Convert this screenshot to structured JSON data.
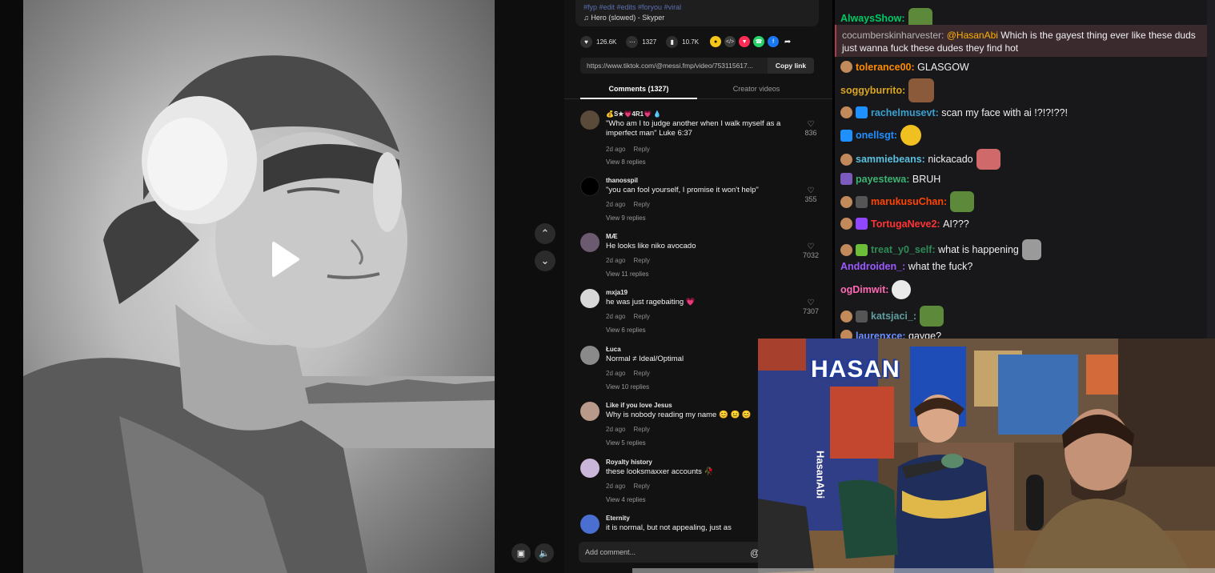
{
  "tiktok": {
    "song_tags": "#fyp #edit #edits #foryou #viral",
    "song": "Hero (slowed) - Skyper",
    "stats": {
      "likes": "126.6K",
      "comments": "1327",
      "saves": "10.7K"
    },
    "link": "https://www.tiktok.com/@messi.fmp/video/753115617...",
    "copy_label": "Copy link",
    "tabs": {
      "comments": "Comments (1327)",
      "creator": "Creator videos"
    },
    "comments": [
      {
        "user": "💰S★💗4R1💗 💧",
        "text": "\"Who am I to judge another when I walk myself as a imperfect man\" Luke 6:37",
        "time": "2d ago",
        "reply": "Reply",
        "views": "View 8 replies",
        "likes": "836"
      },
      {
        "user": "thanosspil",
        "text": "\"you can fool yourself, I promise it won't help\"",
        "time": "2d ago",
        "reply": "Reply",
        "views": "View 9 replies",
        "likes": "355"
      },
      {
        "user": "MÆ",
        "text": "He looks like niko avocado",
        "time": "2d ago",
        "reply": "Reply",
        "views": "View 11 replies",
        "likes": "7032"
      },
      {
        "user": "mxja19",
        "text": "he was just ragebaiting 💗",
        "time": "2d ago",
        "reply": "Reply",
        "views": "View 6 replies",
        "likes": "7307"
      },
      {
        "user": "Łuca",
        "text": "Normal ≠ Ideal/Optimal",
        "time": "2d ago",
        "reply": "Reply",
        "views": "View 10 replies",
        "likes": ""
      },
      {
        "user": "Like if you love Jesus",
        "text": "Why is nobody reading my name 😊 😐 😊",
        "time": "2d ago",
        "reply": "Reply",
        "views": "View 5 replies",
        "likes": ""
      },
      {
        "user": "Royalty history",
        "text": "these looksmaxxer accounts 🥀",
        "time": "2d ago",
        "reply": "Reply",
        "views": "View 4 replies",
        "likes": ""
      },
      {
        "user": "Eternity",
        "text": "it is normal, but not appealing, just as",
        "time": "",
        "reply": "",
        "views": "",
        "likes": ""
      }
    ],
    "add_comment_placeholder": "Add comment..."
  },
  "chat": {
    "messages": [
      {
        "user": "AlwaysShow:",
        "text": "",
        "color": "#00ff7f"
      },
      {
        "user": "tolerance00:",
        "text": "GLASGOW",
        "color": "#ff7f00"
      },
      {
        "user": "soggyburrito:",
        "text": "",
        "color": "#daa520"
      },
      {
        "user": "rachelmusevt:",
        "text": "scan my face with ai !?!?!??!",
        "color": "#5f9ea0"
      },
      {
        "user": "onellsgt:",
        "text": "",
        "color": "#1e90ff"
      },
      {
        "user": "sammiebeans:",
        "text": "nickacado",
        "color": "#5bc0de"
      },
      {
        "user": "payestewa:",
        "text": "BRUH",
        "color": "#3cb371"
      },
      {
        "user": "marukusuChan:",
        "text": "",
        "color": "#ff4500"
      },
      {
        "user": "TortugaNeve2:",
        "text": "AI???",
        "color": "#ff3333"
      },
      {
        "user": "treat_y0_self:",
        "text": "what is happening",
        "color": "#2e8b57"
      },
      {
        "user": "Anddroiden_:",
        "text": "what the fuck?",
        "color": "#9b59ff"
      },
      {
        "user": "ogDimwit:",
        "text": "",
        "color": "#ff69b4"
      },
      {
        "user": "katsjaci_:",
        "text": "",
        "color": "#5f9ea0"
      },
      {
        "user": "laurenxce:",
        "text": "gayge?",
        "color": "#6c8eff"
      }
    ],
    "highlight": {
      "user": "cocumberskinharvester:",
      "mention": "@HasanAbi",
      "line1": "Which is the gayest thing ever like these duds",
      "line2": "just wanna fuck these dudes they find hot",
      "user_color": "#b5b5b5",
      "mention_color": "#ffb000"
    }
  },
  "webcam": {
    "logo": "HASAN",
    "banner": "HasanAbi"
  }
}
